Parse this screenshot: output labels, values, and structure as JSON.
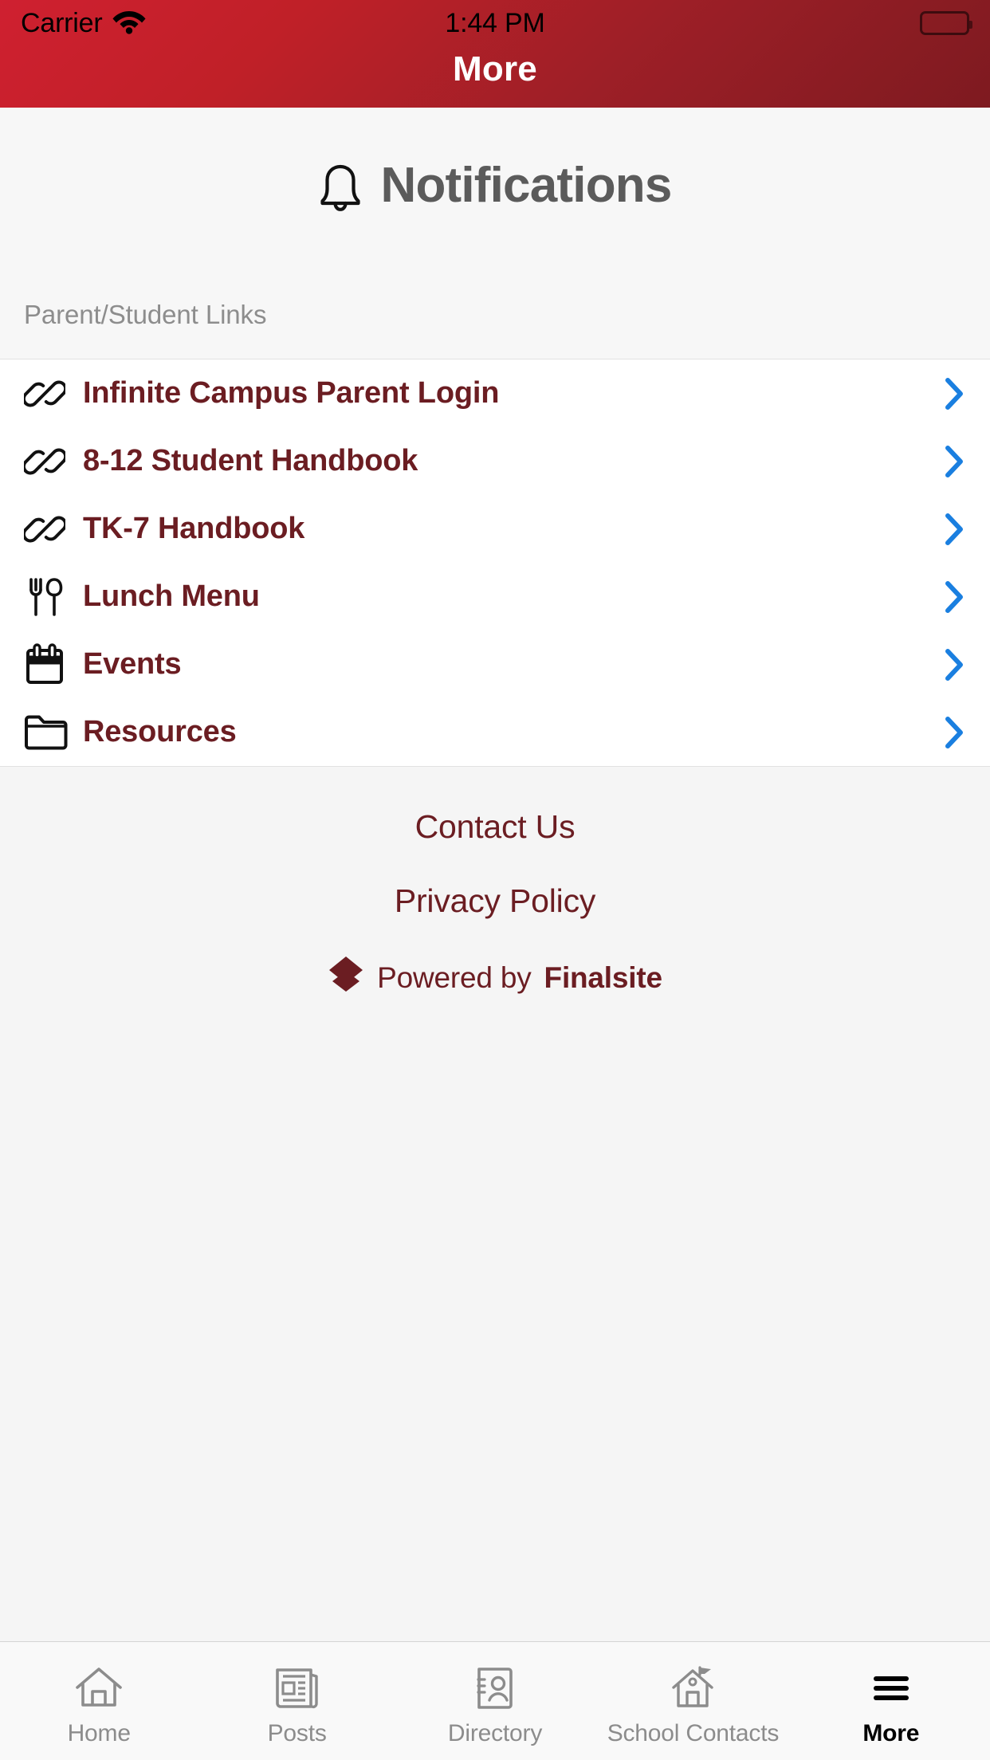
{
  "status_bar": {
    "carrier": "Carrier",
    "time": "1:44 PM",
    "wifi_icon": "wifi-icon",
    "battery_icon": "battery-full-icon"
  },
  "header": {
    "title": "More",
    "background_start": "#cf2030",
    "background_end": "#7e1a20",
    "title_color": "#ffffff"
  },
  "page": {
    "heading": "Notifications",
    "heading_icon": "bell-icon",
    "heading_color": "#5b5b5b"
  },
  "section": {
    "label": "Parent/Student Links",
    "label_color": "#8d8d8d"
  },
  "list": {
    "accent_color": "#6b1d22",
    "chevron_color": "#1a7fe0",
    "items": [
      {
        "label": "Infinite Campus Parent Login",
        "icon": "link-icon",
        "chevron": "chevron-right-icon"
      },
      {
        "label": "8-12 Student Handbook",
        "icon": "link-icon",
        "chevron": "chevron-right-icon"
      },
      {
        "label": "TK-7 Handbook",
        "icon": "link-icon",
        "chevron": "chevron-right-icon"
      },
      {
        "label": "Lunch Menu",
        "icon": "utensils-icon",
        "chevron": "chevron-right-icon"
      },
      {
        "label": "Events",
        "icon": "calendar-icon",
        "chevron": "chevron-right-icon"
      },
      {
        "label": "Resources",
        "icon": "folder-icon",
        "chevron": "chevron-right-icon"
      }
    ]
  },
  "footer": {
    "contact_us": "Contact Us",
    "privacy_policy": "Privacy Policy",
    "powered_prefix": "Powered by",
    "powered_brand": "Finalsite",
    "powered_icon": "finalsite-logo-icon",
    "text_color": "#6b1d22"
  },
  "tab_bar": {
    "active_index": 4,
    "items": [
      {
        "label": "Home",
        "icon": "home-icon"
      },
      {
        "label": "Posts",
        "icon": "newspaper-icon"
      },
      {
        "label": "Directory",
        "icon": "contact-card-icon"
      },
      {
        "label": "School Contacts",
        "icon": "school-house-icon"
      },
      {
        "label": "More",
        "icon": "hamburger-menu-icon"
      }
    ]
  }
}
